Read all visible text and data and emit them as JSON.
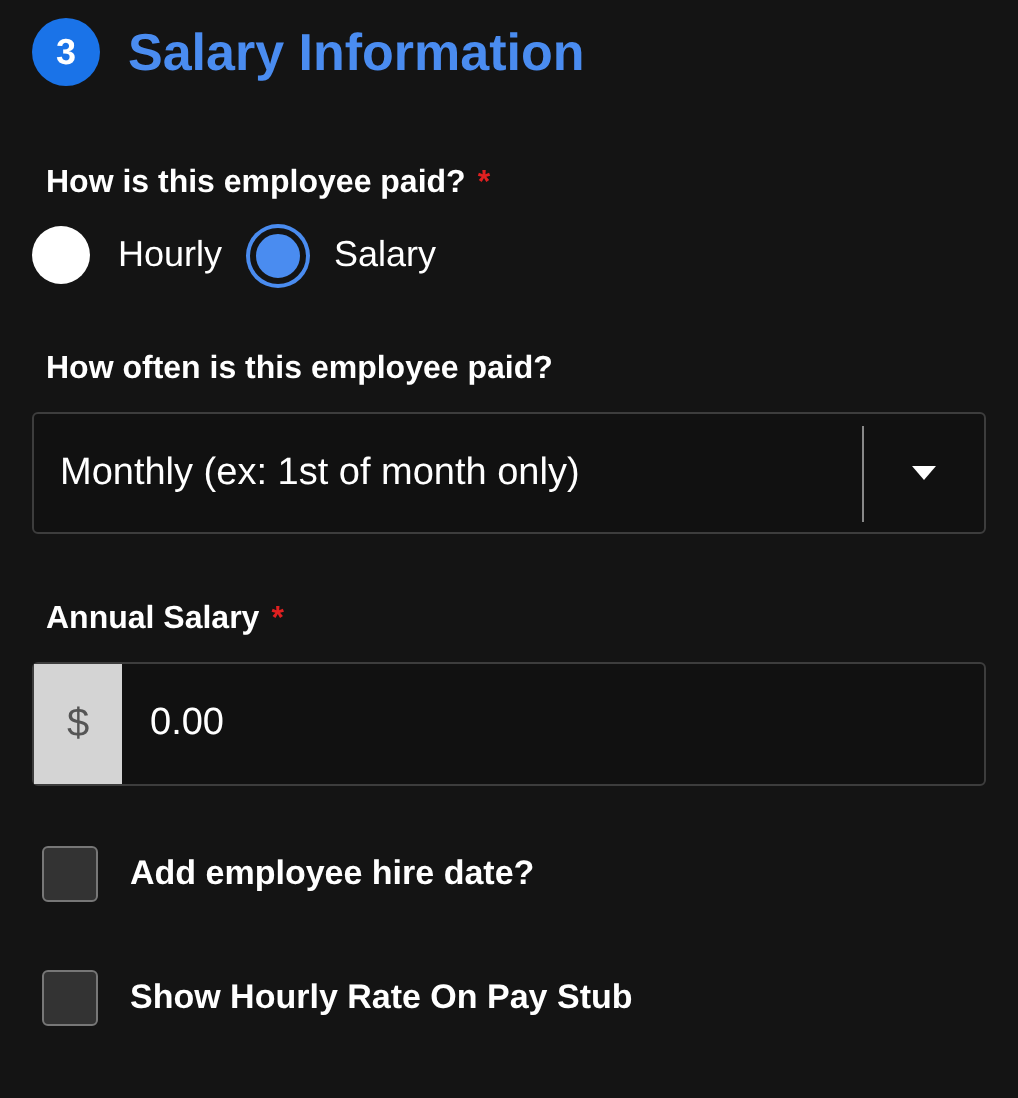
{
  "section": {
    "step": "3",
    "title": "Salary Information"
  },
  "pay_type": {
    "label": "How is this employee paid?",
    "required_mark": "*",
    "options": [
      {
        "label": "Hourly",
        "selected": false
      },
      {
        "label": "Salary",
        "selected": true
      }
    ]
  },
  "pay_frequency": {
    "label": "How often is this employee paid?",
    "value": "Monthly (ex: 1st of month only)"
  },
  "annual_salary": {
    "label": "Annual Salary",
    "required_mark": "*",
    "prefix": "$",
    "value": "0.00"
  },
  "checkboxes": [
    {
      "label": "Add employee hire date?",
      "checked": false
    },
    {
      "label": "Show Hourly Rate On Pay Stub",
      "checked": false
    }
  ]
}
